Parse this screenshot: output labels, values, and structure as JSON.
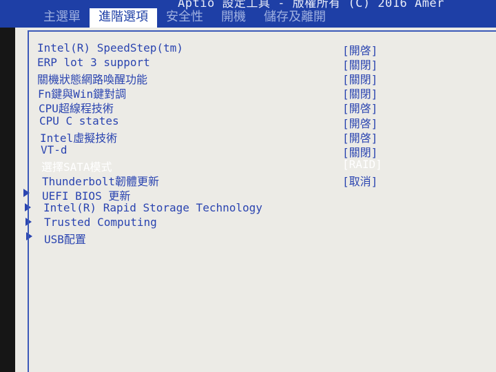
{
  "header": {
    "title": "Aptio 設定工具 - 版權所有 (C) 2016 Amer",
    "tabs": [
      {
        "label": "主選單",
        "active": false
      },
      {
        "label": "進階選項",
        "active": true
      },
      {
        "label": "安全性",
        "active": false
      },
      {
        "label": "開機",
        "active": false
      },
      {
        "label": "儲存及離開",
        "active": false
      }
    ]
  },
  "settings": [
    {
      "label": "Intel(R) SpeedStep(tm)",
      "value": "[開啓]"
    },
    {
      "label": "ERP lot 3 support",
      "value": "[關閉]"
    },
    {
      "label": "關機狀態網路喚醒功能",
      "value": "[關閉]"
    },
    {
      "label": "Fn鍵與Win鍵對調",
      "value": "[關閉]"
    },
    {
      "label": "CPU超線程技術",
      "value": "[開啓]"
    },
    {
      "label": "CPU C states",
      "value": "[開啓]"
    },
    {
      "label": "Intel虛擬技術",
      "value": "[開啓]"
    },
    {
      "label": "VT-d",
      "value": "[關閉]"
    },
    {
      "label": "選擇SATA模式",
      "value": "[RAID]",
      "selected": true
    },
    {
      "label": "Thunderbolt韌體更新",
      "value": "[取消]"
    }
  ],
  "submenus": [
    {
      "label": "UEFI BIOS 更新"
    },
    {
      "label": "Intel(R) Rapid Storage Technology"
    },
    {
      "label": "Trusted Computing"
    },
    {
      "label": "USB配置"
    }
  ],
  "colors": {
    "header_bg": "#1e3fa6",
    "panel_bg": "#ecebe6",
    "text_blue": "#2a44b0",
    "selected_text": "#ffffff"
  }
}
